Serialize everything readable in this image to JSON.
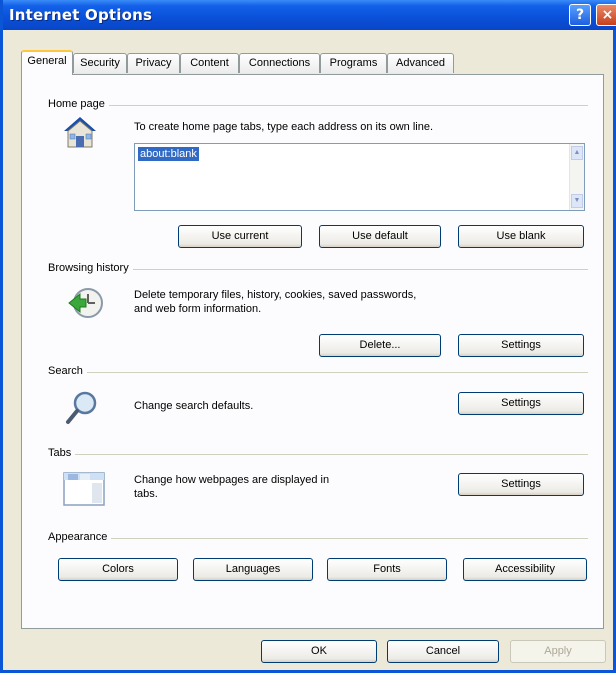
{
  "window": {
    "title": "Internet Options",
    "help_label": "?",
    "close_label": "×"
  },
  "tabs": [
    {
      "label": "General",
      "active": true
    },
    {
      "label": "Security",
      "active": false
    },
    {
      "label": "Privacy",
      "active": false
    },
    {
      "label": "Content",
      "active": false
    },
    {
      "label": "Connections",
      "active": false
    },
    {
      "label": "Programs",
      "active": false
    },
    {
      "label": "Advanced",
      "active": false
    }
  ],
  "home_page": {
    "group_label": "Home page",
    "description": "To create home page tabs, type each address on its own line.",
    "value": "about:blank",
    "buttons": {
      "use_current": "Use current",
      "use_default": "Use default",
      "use_blank": "Use blank"
    }
  },
  "browsing_history": {
    "group_label": "Browsing history",
    "description_line1": "Delete temporary files, history, cookies, saved passwords,",
    "description_line2": "and web form information.",
    "buttons": {
      "delete": "Delete...",
      "settings": "Settings"
    }
  },
  "search": {
    "group_label": "Search",
    "description": "Change search defaults.",
    "buttons": {
      "settings": "Settings"
    }
  },
  "tabs_group": {
    "group_label": "Tabs",
    "description_line1": "Change how webpages are displayed in",
    "description_line2": "tabs.",
    "buttons": {
      "settings": "Settings"
    }
  },
  "appearance": {
    "group_label": "Appearance",
    "buttons": {
      "colors": "Colors",
      "languages": "Languages",
      "fonts": "Fonts",
      "accessibility": "Accessibility"
    }
  },
  "footer": {
    "ok": "OK",
    "cancel": "Cancel",
    "apply": "Apply"
  },
  "colors": {
    "titlebar": "#0a50d8",
    "selection": "#316ac5",
    "active_tab_accent": "#ffc83c"
  }
}
